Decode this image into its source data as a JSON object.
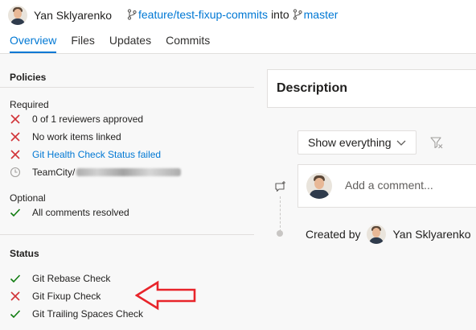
{
  "header": {
    "author": "Yan Sklyarenko",
    "source_branch": "feature/test-fixup-commits",
    "into_text": "into",
    "target_branch": "master",
    "tabs": [
      {
        "label": "Overview",
        "active": true
      },
      {
        "label": "Files",
        "active": false
      },
      {
        "label": "Updates",
        "active": false
      },
      {
        "label": "Commits",
        "active": false
      }
    ]
  },
  "policies": {
    "title": "Policies",
    "required_label": "Required",
    "required": [
      {
        "status": "failed",
        "icon": "x-icon",
        "text": "0 of 1 reviewers approved",
        "link": false
      },
      {
        "status": "failed",
        "icon": "x-icon",
        "text": "No work items linked",
        "link": false
      },
      {
        "status": "failed",
        "icon": "x-icon",
        "text": "Git Health Check Status failed",
        "link": true
      },
      {
        "status": "pending",
        "icon": "clock-icon",
        "text": "TeamCity/",
        "link": false
      }
    ],
    "optional_label": "Optional",
    "optional": [
      {
        "status": "passed",
        "icon": "check-icon",
        "text": "All comments resolved"
      }
    ]
  },
  "status": {
    "title": "Status",
    "items": [
      {
        "status": "passed",
        "icon": "check-icon",
        "text": "Git Rebase Check"
      },
      {
        "status": "failed",
        "icon": "x-icon",
        "text": "Git Fixup Check"
      },
      {
        "status": "passed",
        "icon": "check-icon",
        "text": "Git Trailing Spaces Check"
      }
    ]
  },
  "description": {
    "title": "Description"
  },
  "activity": {
    "filter_value": "Show everything",
    "comment_placeholder": "Add a comment...",
    "created_by_label": "Created by",
    "created_by_name": "Yan Sklyarenko"
  },
  "colors": {
    "accent": "#0078d4",
    "fail": "#d13438",
    "pass": "#107c10",
    "annotation": "#e8242a"
  }
}
